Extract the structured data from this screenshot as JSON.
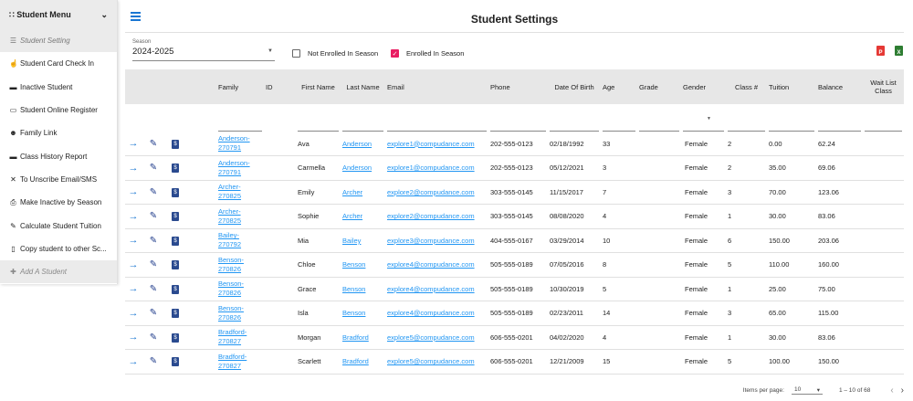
{
  "menu": {
    "title": "Student Menu",
    "items": [
      {
        "icon": "☰",
        "label": "Student Setting",
        "state": "active"
      },
      {
        "icon": "☝",
        "label": "Student Card Check In"
      },
      {
        "icon": "▬",
        "label": "Inactive Student"
      },
      {
        "icon": "▭",
        "label": "Student Online Register"
      },
      {
        "icon": "☻",
        "label": "Family Link"
      },
      {
        "icon": "▬",
        "label": "Class History Report"
      },
      {
        "icon": "✕",
        "label": "To Unscribe Email/SMS"
      },
      {
        "icon": "⎙",
        "label": "Make Inactive by Season"
      },
      {
        "icon": "✎",
        "label": "Calculate Student Tuition"
      },
      {
        "icon": "▯",
        "label": "Copy student to other Sc..."
      },
      {
        "icon": "✚",
        "label": "Add A Student",
        "state": "add"
      }
    ]
  },
  "header": {
    "title": "Student Settings"
  },
  "filters": {
    "season_label": "Season",
    "season_value": "2024-2025",
    "not_enrolled": "Not Enrolled In Season",
    "enrolled": "Enrolled In Season",
    "not_enrolled_checked": false,
    "enrolled_checked": true
  },
  "colors": {
    "accent": "#1976d2",
    "pdf": "#e53935",
    "excel": "#2e7d32",
    "checkbox": "#e91e63"
  },
  "table": {
    "headers": [
      "Family",
      "ID",
      "First Name",
      "Last Name",
      "Email",
      "Phone",
      "Date Of Birth",
      "Age",
      "Grade",
      "Gender",
      "Class #",
      "Tuition",
      "Balance",
      "Wait List Class"
    ],
    "rows": [
      {
        "family": "Anderson-270791",
        "id": "",
        "first": "Ava",
        "last": "Anderson",
        "email": "explore1@compudance.com",
        "phone": "202-555-0123",
        "dob": "02/18/1992",
        "age": "33",
        "grade": "",
        "gender": "Female",
        "class": "2",
        "tuition": "0.00",
        "balance": "62.24",
        "wait": ""
      },
      {
        "family": "Anderson-270791",
        "id": "",
        "first": "Carmella",
        "last": "Anderson",
        "email": "explore1@compudance.com",
        "phone": "202-555-0123",
        "dob": "05/12/2021",
        "age": "3",
        "grade": "",
        "gender": "Female",
        "class": "2",
        "tuition": "35.00",
        "balance": "69.06",
        "wait": ""
      },
      {
        "family": "Archer-270825",
        "id": "",
        "first": "Emily",
        "last": "Archer",
        "email": "explore2@compudance.com",
        "phone": "303-555-0145",
        "dob": "11/15/2017",
        "age": "7",
        "grade": "",
        "gender": "Female",
        "class": "3",
        "tuition": "70.00",
        "balance": "123.06",
        "wait": ""
      },
      {
        "family": "Archer-270825",
        "id": "",
        "first": "Sophie",
        "last": "Archer",
        "email": "explore2@compudance.com",
        "phone": "303-555-0145",
        "dob": "08/08/2020",
        "age": "4",
        "grade": "",
        "gender": "Female",
        "class": "1",
        "tuition": "30.00",
        "balance": "83.06",
        "wait": ""
      },
      {
        "family": "Bailey-270792",
        "id": "",
        "first": "Mia",
        "last": "Bailey",
        "email": "explore3@compudance.com",
        "phone": "404-555-0167",
        "dob": "03/29/2014",
        "age": "10",
        "grade": "",
        "gender": "Female",
        "class": "6",
        "tuition": "150.00",
        "balance": "203.06",
        "wait": ""
      },
      {
        "family": "Benson-270826",
        "id": "",
        "first": "Chloe",
        "last": "Benson",
        "email": "explore4@compudance.com",
        "phone": "505-555-0189",
        "dob": "07/05/2016",
        "age": "8",
        "grade": "",
        "gender": "Female",
        "class": "5",
        "tuition": "110.00",
        "balance": "160.00",
        "wait": ""
      },
      {
        "family": "Benson-270826",
        "id": "",
        "first": "Grace",
        "last": "Benson",
        "email": "explore4@compudance.com",
        "phone": "505-555-0189",
        "dob": "10/30/2019",
        "age": "5",
        "grade": "",
        "gender": "Female",
        "class": "1",
        "tuition": "25.00",
        "balance": "75.00",
        "wait": ""
      },
      {
        "family": "Benson-270826",
        "id": "",
        "first": "Isla",
        "last": "Benson",
        "email": "explore4@compudance.com",
        "phone": "505-555-0189",
        "dob": "02/23/2011",
        "age": "14",
        "grade": "",
        "gender": "Female",
        "class": "3",
        "tuition": "65.00",
        "balance": "115.00",
        "wait": ""
      },
      {
        "family": "Bradford-270827",
        "id": "",
        "first": "Morgan",
        "last": "Bradford",
        "email": "explore5@compudance.com",
        "phone": "606-555-0201",
        "dob": "04/02/2020",
        "age": "4",
        "grade": "",
        "gender": "Female",
        "class": "1",
        "tuition": "30.00",
        "balance": "83.06",
        "wait": ""
      },
      {
        "family": "Bradford-270827",
        "id": "",
        "first": "Scarlett",
        "last": "Bradford",
        "email": "explore5@compudance.com",
        "phone": "606-555-0201",
        "dob": "12/21/2009",
        "age": "15",
        "grade": "",
        "gender": "Female",
        "class": "5",
        "tuition": "100.00",
        "balance": "150.00",
        "wait": ""
      }
    ]
  },
  "pager": {
    "label": "Items per page:",
    "size": "10",
    "range": "1 – 10 of 68"
  }
}
